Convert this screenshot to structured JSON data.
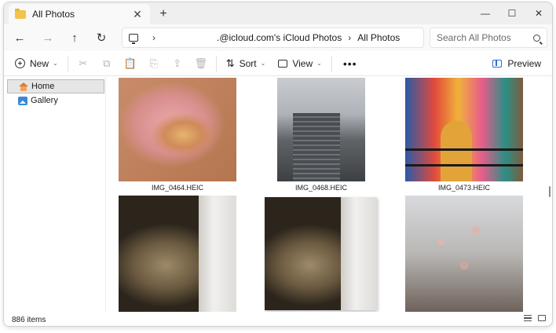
{
  "tab": {
    "title": "All Photos",
    "close": "✕",
    "new_tab": "+"
  },
  "window_controls": {
    "minimize": "—",
    "maximize": "☐",
    "close": "✕"
  },
  "nav": {
    "back": "←",
    "forward": "→",
    "up": "↑",
    "refresh": "↻"
  },
  "address": {
    "sep1": "›",
    "location": ".@icloud.com's iCloud Photos",
    "sep2": "›",
    "current": "All Photos"
  },
  "search": {
    "placeholder": "Search All Photos"
  },
  "commandbar": {
    "new_label": "New",
    "sort_label": "Sort",
    "view_label": "View",
    "more": "•••",
    "preview_label": "Preview",
    "chevron": "⌄",
    "cut_icon": "✂",
    "copy_icon": "⧉",
    "paste_icon": "📋",
    "rename_icon": "⎘",
    "share_icon": "⇪",
    "delete_icon": "🗑",
    "sort_icon": "⇅"
  },
  "sidebar": {
    "items": [
      {
        "label": "Home",
        "icon": "home-icon",
        "active": true
      },
      {
        "label": "Gallery",
        "icon": "gallery-icon",
        "active": false
      }
    ]
  },
  "photos": [
    {
      "caption": "IMG_0464.HEIC"
    },
    {
      "caption": "IMG_0468.HEIC"
    },
    {
      "caption": "IMG_0473.HEIC"
    },
    {
      "caption": ""
    },
    {
      "caption": ""
    },
    {
      "caption": ""
    }
  ],
  "status": {
    "item_count": "886 items"
  },
  "colors": {
    "accent": "#2a6fd6",
    "selection": "#e6e6e6",
    "titlebar": "#efefef"
  }
}
